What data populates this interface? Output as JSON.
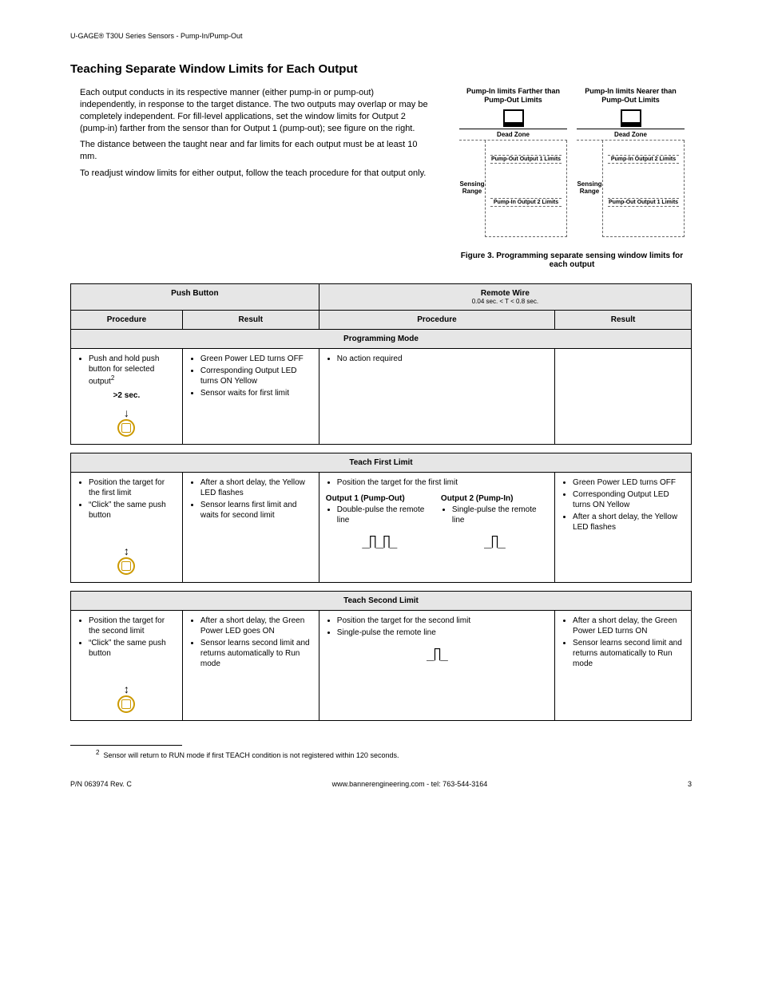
{
  "header": "U-GAGE® T30U Series Sensors - Pump-In/Pump-Out",
  "title": "Teaching Separate Window Limits for Each Output",
  "intro": {
    "p1": "Each output conducts in its respective manner (either pump-in or pump-out) independently, in response to the target distance. The two outputs may overlap or may be completely independent. For fill-level applications, set the window limits for Output 2 (pump-in) farther from the sensor than for Output 1 (pump-out); see figure on the right.",
    "p2": "The distance between the taught near and far limits for each output must be at least 10 mm.",
    "p3": "To readjust window limits for either output, follow the teach procedure for that output only."
  },
  "figure": {
    "left_title": "Pump-In limits Farther than Pump-Out Limits",
    "right_title": "Pump-In limits Nearer than Pump-Out Limits",
    "deadzone": "Dead Zone",
    "sensing_range": "Sensing Range",
    "pump_out_1": "Pump-Out Output 1 Limits",
    "pump_in_2": "Pump-In Output 2 Limits",
    "caption": "Figure 3. Programming separate sensing window limits for each output"
  },
  "table": {
    "push_button": "Push Button",
    "remote_wire": "Remote Wire",
    "remote_sub": "0.04 sec. < T < 0.8 sec.",
    "procedure": "Procedure",
    "result": "Result",
    "prog_mode": "Programming Mode",
    "r1c1a": "Push and hold push button for selected output",
    "r1c1_time": ">2 sec.",
    "r1c2a": "Green Power LED turns OFF",
    "r1c2b": "Corresponding Output LED turns ON Yellow",
    "r1c2c": "Sensor waits for first limit",
    "r1c3a": "No action required",
    "teach_first": "Teach First Limit",
    "r2c1a": "Position the target for the first limit",
    "r2c1b": "“Click” the same push button",
    "r2c2a": "After a short delay, the Yellow LED flashes",
    "r2c2b": "Sensor learns first limit and waits for second limit",
    "r2c3_top": "Position the target for the first limit",
    "r2c3_o1h": "Output 1 (Pump-Out)",
    "r2c3_o1b": "Double-pulse the remote line",
    "r2c3_o2h": "Output 2 (Pump-In)",
    "r2c3_o2b": "Single-pulse the remote line",
    "r2c4a": "Green Power LED turns OFF",
    "r2c4b": "Corresponding Output LED turns ON Yellow",
    "r2c4c": "After a short delay, the Yellow LED flashes",
    "teach_second": "Teach Second Limit",
    "r3c1a": "Position the target for the second limit",
    "r3c1b": "“Click” the same push button",
    "r3c2a": "After a short delay, the Green Power LED goes ON",
    "r3c2b": "Sensor learns second limit and returns automatically to Run mode",
    "r3c3a": "Position the target for the second limit",
    "r3c3b": "Single-pulse the remote line",
    "r3c4a": "After a short delay, the Green Power LED turns ON",
    "r3c4b": "Sensor learns second limit and returns automatically to Run mode"
  },
  "footnote": {
    "num": "2",
    "text": "Sensor will return to RUN mode if first TEACH condition is not registered within 120 seconds."
  },
  "footer": {
    "left": "P/N 063974 Rev. C",
    "center": "www.bannerengineering.com - tel: 763-544-3164",
    "right": "3"
  }
}
